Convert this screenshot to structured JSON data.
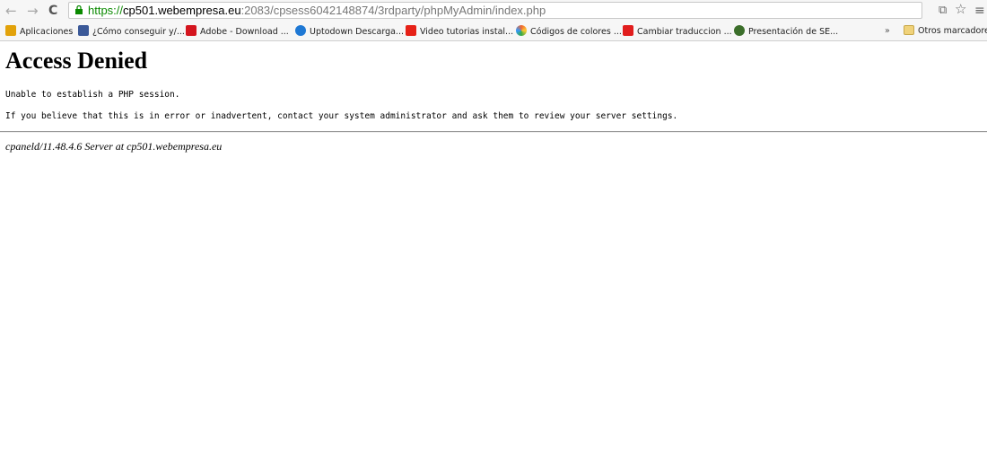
{
  "browser": {
    "url": {
      "scheme": "https://",
      "host": "cp501.webempresa.eu",
      "path": ":2083/cpsess6042148874/3rdparty/phpMyAdmin/index.php"
    },
    "icons": {
      "back": "back-arrow-icon",
      "forward": "forward-arrow-icon",
      "reload": "reload-icon",
      "lock": "lock-icon",
      "translate": "translate-icon",
      "star": "star-icon",
      "menu": "menu-icon"
    },
    "bookmarks": [
      {
        "label": "Aplicaciones",
        "icon": "apps-grid-icon",
        "color": "#e2a20a"
      },
      {
        "label": "¿Cómo conseguir y/...",
        "icon": "facebook-icon",
        "color": "#3b5998"
      },
      {
        "label": "Adobe - Download ...",
        "icon": "adobe-icon",
        "color": "#d4151e"
      },
      {
        "label": "Uptodown Descarga...",
        "icon": "uptodown-icon",
        "color": "#1e78d4"
      },
      {
        "label": "Video tutorias instal...",
        "icon": "youtube-icon",
        "color": "#e62117"
      },
      {
        "label": "Códigos de colores ...",
        "icon": "color-wheel-icon",
        "color": "#3aa648"
      },
      {
        "label": "Cambiar traduccion ...",
        "icon": "w-icon",
        "color": "#e11d1d"
      },
      {
        "label": "Presentación de SE...",
        "icon": "figure-icon",
        "color": "#3b6e2a"
      }
    ],
    "overflow": "»",
    "other_bookmarks": "Otros marcadores"
  },
  "page": {
    "title": "Access Denied",
    "message1": "Unable to establish a PHP session.",
    "message2": "If you believe that this is in error or inadvertent, contact your system administrator and ask them to review your server settings.",
    "server_signature": "cpaneld/11.48.4.6 Server at cp501.webempresa.eu"
  }
}
